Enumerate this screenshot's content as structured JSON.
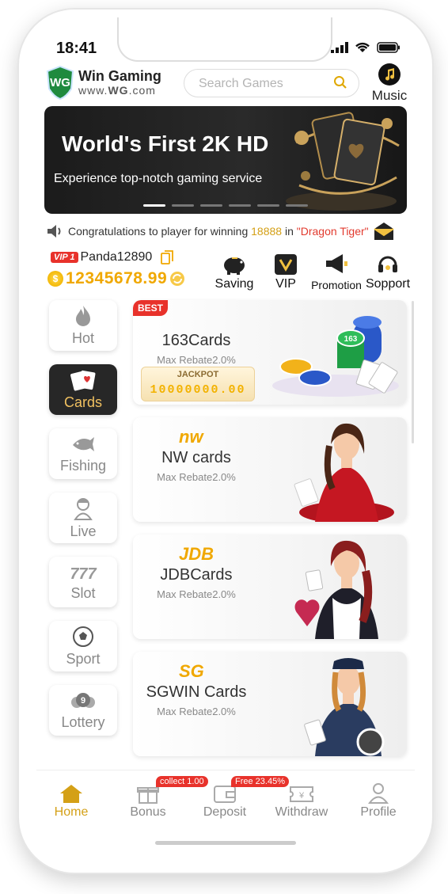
{
  "status": {
    "time": "18:41"
  },
  "header": {
    "logo_mark": "WG",
    "brand": "Win Gaming",
    "url_prefix": "www.",
    "url_bold": "WG",
    "url_suffix": ".com",
    "search_placeholder": "Search Games",
    "music_label": "Music"
  },
  "banner": {
    "title": "World's First 2K HD",
    "subtitle": "Experience top-notch gaming service",
    "slide_count": 6,
    "active_slide": 0
  },
  "marquee": {
    "prefix": "Congratulations to player for winning",
    "amount": "18888",
    "mid": "in",
    "game": "\"Dragon Tiger\""
  },
  "user": {
    "vip": "VIP 1",
    "name": "Panda12890",
    "balance": "12345678.99"
  },
  "quick_actions": [
    {
      "label": "Saving",
      "icon": "piggy-bank-icon"
    },
    {
      "label": "VIP",
      "icon": "vip-crown-icon"
    },
    {
      "label": "Promotion",
      "icon": "megaphone-icon"
    },
    {
      "label": "Sopport",
      "icon": "headset-icon"
    }
  ],
  "categories": [
    {
      "label": "Hot",
      "icon": "flame-icon",
      "active": false
    },
    {
      "label": "Cards",
      "icon": "cards-icon",
      "active": true
    },
    {
      "label": "Fishing",
      "icon": "fish-icon",
      "active": false
    },
    {
      "label": "Live",
      "icon": "dealer-icon",
      "active": false
    },
    {
      "label": "Slot",
      "icon": "slot-777-icon",
      "active": false
    },
    {
      "label": "Sport",
      "icon": "soccer-ball-icon",
      "active": false
    },
    {
      "label": "Lottery",
      "icon": "lottery-ball-icon",
      "active": false
    }
  ],
  "games": [
    {
      "name": "163Cards",
      "rebate": "Max Rebate2.0%",
      "badge": "BEST",
      "jackpot_label": "JACKPOT",
      "jackpot_value": "10000000.00",
      "chip_label": "163"
    },
    {
      "name": "NW cards",
      "rebate": "Max Rebate2.0%",
      "provider": "nw"
    },
    {
      "name": "JDBCards",
      "rebate": "Max Rebate2.0%",
      "provider": "JDB"
    },
    {
      "name": "SGWIN Cards",
      "rebate": "Max Rebate2.0%",
      "provider": "SG"
    }
  ],
  "tabbar": [
    {
      "label": "Home",
      "icon": "home-icon",
      "active": true
    },
    {
      "label": "Bonus",
      "icon": "gift-icon",
      "badge": "collect 1.00"
    },
    {
      "label": "Deposit",
      "icon": "wallet-icon",
      "badge": "Free 23.45%"
    },
    {
      "label": "Withdraw",
      "icon": "ticket-icon"
    },
    {
      "label": "Profile",
      "icon": "person-icon"
    }
  ],
  "colors": {
    "accent_gold": "#d4a017",
    "balance_gold": "#f0a800",
    "badge_red": "#e8322b",
    "active_tab_bg": "#272727"
  }
}
